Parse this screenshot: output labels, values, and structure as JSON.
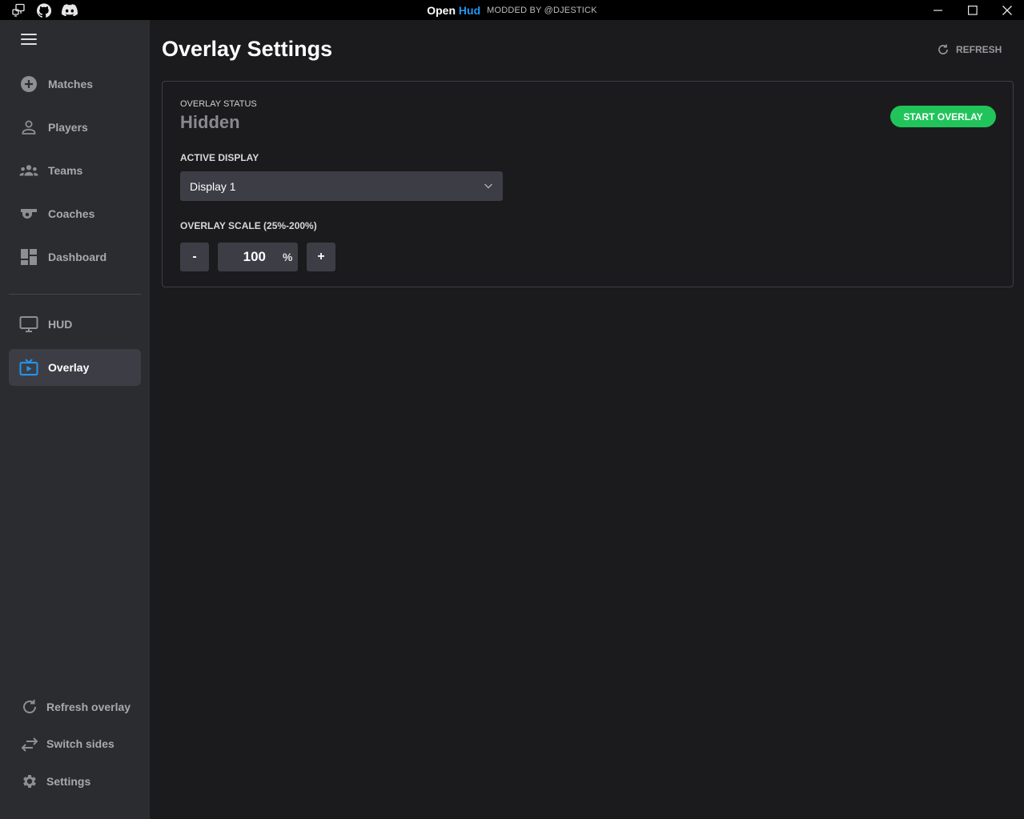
{
  "titlebar": {
    "brand_open": "Open",
    "brand_hud": "Hud",
    "modded_by": "MODDED BY @DJESTICK",
    "icons": [
      "remote-desktop-icon",
      "github-icon",
      "discord-icon"
    ],
    "window_controls": [
      "minimize-icon",
      "maximize-icon",
      "close-icon"
    ]
  },
  "sidebar": {
    "items": [
      {
        "label": "Matches",
        "icon": "add-circle-icon"
      },
      {
        "label": "Players",
        "icon": "person-icon"
      },
      {
        "label": "Teams",
        "icon": "group-icon"
      },
      {
        "label": "Coaches",
        "icon": "whistle-icon"
      },
      {
        "label": "Dashboard",
        "icon": "dashboard-icon"
      },
      {
        "label": "HUD",
        "icon": "monitor-icon"
      },
      {
        "label": "Overlay",
        "icon": "tv-play-icon",
        "active": true
      }
    ],
    "bottom": [
      {
        "label": "Refresh overlay",
        "icon": "refresh-icon"
      },
      {
        "label": "Switch sides",
        "icon": "swap-icon"
      },
      {
        "label": "Settings",
        "icon": "gear-icon"
      }
    ]
  },
  "main": {
    "title": "Overlay Settings",
    "refresh_label": "REFRESH",
    "status_label": "OVERLAY STATUS",
    "status_value": "Hidden",
    "start_button": "START OVERLAY",
    "display_label": "ACTIVE DISPLAY",
    "display_value": "Display 1",
    "scale_label": "OVERLAY SCALE (25%-200%)",
    "scale_minus": "-",
    "scale_value": "100",
    "scale_unit": "%",
    "scale_plus": "+"
  },
  "colors": {
    "accent_blue": "#2196f3",
    "start_green": "#21c45a",
    "sidebar_bg": "#2b2c30",
    "main_bg": "#1b1b1e"
  }
}
